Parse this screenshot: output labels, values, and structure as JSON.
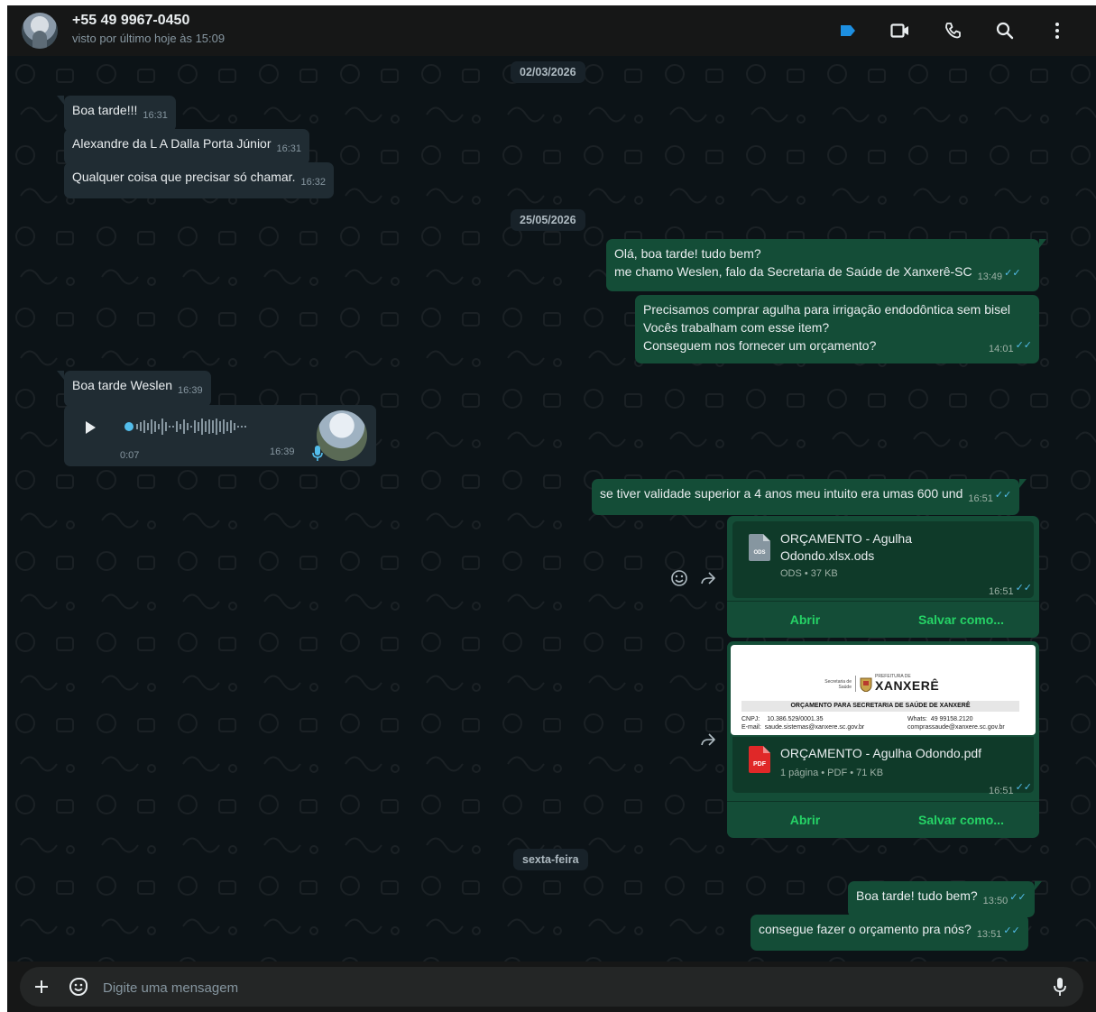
{
  "header": {
    "contact_name": "+55 49 9967-0450",
    "status": "visto por último hoje às 15:09"
  },
  "dates": {
    "d1": "02/03/2026",
    "d2": "25/05/2026",
    "d3": "sexta-feira"
  },
  "messages": {
    "m1": {
      "text": "Boa tarde!!!",
      "time": "16:31"
    },
    "m2": {
      "text": "Alexandre da L A Dalla Porta Júnior",
      "time": "16:31"
    },
    "m3": {
      "text": "Qualquer coisa que precisar só chamar.",
      "time": "16:32"
    },
    "m4": {
      "line1": "Olá, boa tarde! tudo bem?",
      "line2": "me chamo Weslen, falo da Secretaria de Saúde de Xanxerê-SC",
      "time": "13:49"
    },
    "m5": {
      "line1": "Precisamos comprar agulha para irrigação endodôntica sem bisel",
      "line2": "Vocês trabalham com esse item?",
      "line3": "Conseguem nos fornecer um orçamento?",
      "time": "14:01"
    },
    "m6": {
      "text": "Boa tarde Weslen",
      "time": "16:39"
    },
    "voice": {
      "duration": "0:07",
      "time": "16:39"
    },
    "m7": {
      "text": "se tiver validade superior a 4 anos meu intuito era umas 600 und",
      "time": "16:51"
    },
    "m8": {
      "text": "Boa tarde! tudo bem?",
      "time": "13:50"
    },
    "m9": {
      "text": "consegue fazer o orçamento pra nós?",
      "time": "13:51"
    }
  },
  "doc1": {
    "name_line1": "ORÇAMENTO - Agulha",
    "name_line2": "Odondo.xlsx.ods",
    "icon_label": "ODS",
    "meta": "ODS • 37 KB",
    "time": "16:51",
    "open_label": "Abrir",
    "save_label": "Salvar como..."
  },
  "doc2": {
    "name": "ORÇAMENTO - Agulha Odondo.pdf",
    "icon_label": "PDF",
    "meta": "1 página • PDF • 71 KB",
    "time": "16:51",
    "open_label": "Abrir",
    "save_label": "Salvar como...",
    "preview": {
      "secretaria_line1": "Secretaria de",
      "secretaria_line2": "Saúde",
      "prefeitura": "PREFEITURA DE",
      "city": "XANXERÊ",
      "title": "ORÇAMENTO PARA SECRETARIA DE SAÚDE DE XANXERÊ",
      "cnpj_label": "CNPJ:",
      "cnpj": "10.386.529/0001.35",
      "email_label": "E-mail:",
      "email": "saude.sistemas@xanxere.sc.gov.br",
      "whats_label": "Whats:",
      "whats": "49 99158.2120",
      "email2": "comprassaude@xanxere.sc.gov.br"
    }
  },
  "composer": {
    "placeholder": "Digite uma mensagem"
  },
  "colors": {
    "accent": "#25d366",
    "outgoing": "#144d37",
    "incoming": "#202c33",
    "read_ticks": "#53bdeb",
    "label_blue": "#1d8fe1",
    "pdf_red": "#e02828"
  }
}
